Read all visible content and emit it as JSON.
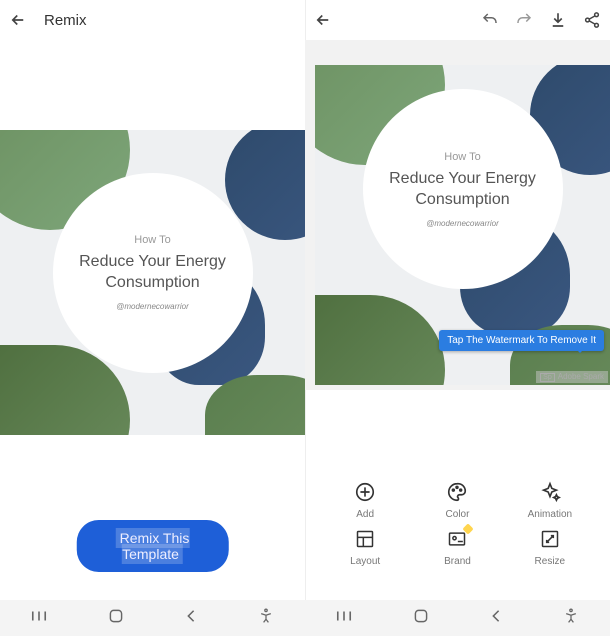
{
  "left": {
    "title": "Remix",
    "artwork": {
      "howto": "How To",
      "title": "Reduce Your Energy Consumption",
      "handle": "@modernecowarrior"
    },
    "remix_button": "Remix This Template"
  },
  "right": {
    "artwork": {
      "howto": "How To",
      "title": "Reduce Your Energy Consumption",
      "handle": "@modernecowarrior"
    },
    "watermark_tip": "Tap The Watermark To Remove It",
    "watermark_label": "Adobe Spark",
    "watermark_badge": "Sp",
    "tools": {
      "add": "Add",
      "color": "Color",
      "animation": "Animation",
      "layout": "Layout",
      "brand": "Brand",
      "resize": "Resize"
    }
  },
  "nav": {
    "recents": "|||",
    "home": "◯",
    "back": "<",
    "accessibility": "⋔"
  }
}
